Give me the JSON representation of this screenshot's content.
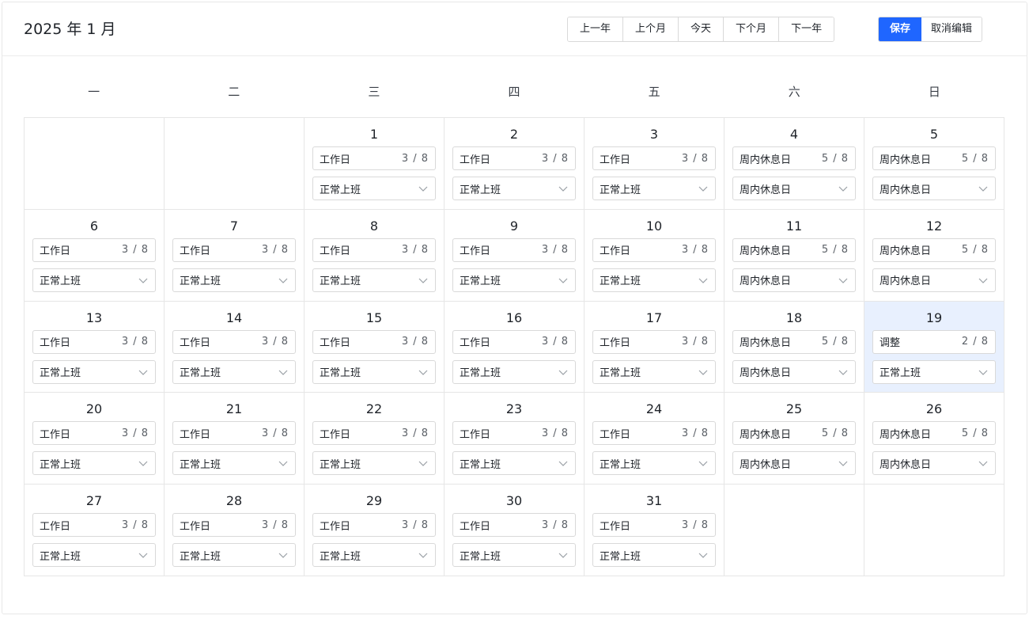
{
  "header": {
    "title": "2025 年 1 月",
    "nav": [
      "上一年",
      "上个月",
      "今天",
      "下个月",
      "下一年"
    ],
    "save_label": "保存",
    "cancel_label": "取消编辑"
  },
  "colors": {
    "primary": "#1f66ff",
    "selected_bg": "#e8f0fe",
    "border": "#d9d9d9"
  },
  "weekdays": [
    "一",
    "二",
    "三",
    "四",
    "五",
    "六",
    "日"
  ],
  "leading_blanks": 2,
  "selected_day": "19",
  "days": [
    {
      "day": "1",
      "type": "工作日",
      "count": "3 / 8",
      "status": "正常上班"
    },
    {
      "day": "2",
      "type": "工作日",
      "count": "3 / 8",
      "status": "正常上班"
    },
    {
      "day": "3",
      "type": "工作日",
      "count": "3 / 8",
      "status": "正常上班"
    },
    {
      "day": "4",
      "type": "周内休息日",
      "count": "5 / 8",
      "status": "周内休息日"
    },
    {
      "day": "5",
      "type": "周内休息日",
      "count": "5 / 8",
      "status": "周内休息日"
    },
    {
      "day": "6",
      "type": "工作日",
      "count": "3 / 8",
      "status": "正常上班"
    },
    {
      "day": "7",
      "type": "工作日",
      "count": "3 / 8",
      "status": "正常上班"
    },
    {
      "day": "8",
      "type": "工作日",
      "count": "3 / 8",
      "status": "正常上班"
    },
    {
      "day": "9",
      "type": "工作日",
      "count": "3 / 8",
      "status": "正常上班"
    },
    {
      "day": "10",
      "type": "工作日",
      "count": "3 / 8",
      "status": "正常上班"
    },
    {
      "day": "11",
      "type": "周内休息日",
      "count": "5 / 8",
      "status": "周内休息日"
    },
    {
      "day": "12",
      "type": "周内休息日",
      "count": "5 / 8",
      "status": "周内休息日"
    },
    {
      "day": "13",
      "type": "工作日",
      "count": "3 / 8",
      "status": "正常上班"
    },
    {
      "day": "14",
      "type": "工作日",
      "count": "3 / 8",
      "status": "正常上班"
    },
    {
      "day": "15",
      "type": "工作日",
      "count": "3 / 8",
      "status": "正常上班"
    },
    {
      "day": "16",
      "type": "工作日",
      "count": "3 / 8",
      "status": "正常上班"
    },
    {
      "day": "17",
      "type": "工作日",
      "count": "3 / 8",
      "status": "正常上班"
    },
    {
      "day": "18",
      "type": "周内休息日",
      "count": "5 / 8",
      "status": "周内休息日"
    },
    {
      "day": "19",
      "type": "调整",
      "count": "2 / 8",
      "status": "正常上班"
    },
    {
      "day": "20",
      "type": "工作日",
      "count": "3 / 8",
      "status": "正常上班"
    },
    {
      "day": "21",
      "type": "工作日",
      "count": "3 / 8",
      "status": "正常上班"
    },
    {
      "day": "22",
      "type": "工作日",
      "count": "3 / 8",
      "status": "正常上班"
    },
    {
      "day": "23",
      "type": "工作日",
      "count": "3 / 8",
      "status": "正常上班"
    },
    {
      "day": "24",
      "type": "工作日",
      "count": "3 / 8",
      "status": "正常上班"
    },
    {
      "day": "25",
      "type": "周内休息日",
      "count": "5 / 8",
      "status": "周内休息日"
    },
    {
      "day": "26",
      "type": "周内休息日",
      "count": "5 / 8",
      "status": "周内休息日"
    },
    {
      "day": "27",
      "type": "工作日",
      "count": "3 / 8",
      "status": "正常上班"
    },
    {
      "day": "28",
      "type": "工作日",
      "count": "3 / 8",
      "status": "正常上班"
    },
    {
      "day": "29",
      "type": "工作日",
      "count": "3 / 8",
      "status": "正常上班"
    },
    {
      "day": "30",
      "type": "工作日",
      "count": "3 / 8",
      "status": "正常上班"
    },
    {
      "day": "31",
      "type": "工作日",
      "count": "3 / 8",
      "status": "正常上班"
    }
  ]
}
